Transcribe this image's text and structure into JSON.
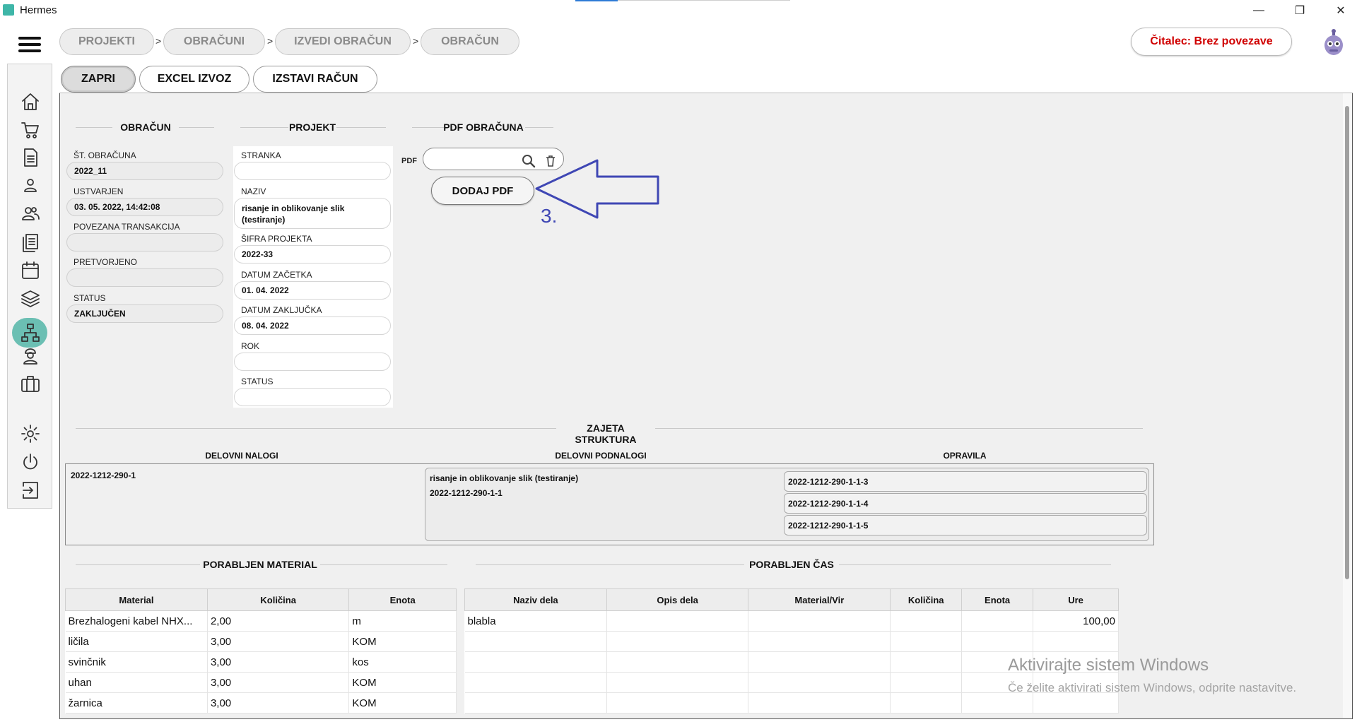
{
  "window": {
    "title": "Hermes",
    "minimize": "—",
    "maximize": "❐",
    "close": "✕"
  },
  "breadcrumb": [
    "PROJEKTI",
    "OBRAČUNI",
    "IZVEDI OBRAČUN",
    "OBRAČUN"
  ],
  "breadcrumb_sep": ">",
  "reader": "Čitalec: Brez povezave",
  "toolbar": {
    "close": "ZAPRI",
    "excel": "EXCEL IZVOZ",
    "invoice": "IZSTAVI RAČUN"
  },
  "obracun": {
    "title": "OBRAČUN",
    "fields": [
      {
        "label": "ŠT. OBRAČUNA",
        "value": "2022_11"
      },
      {
        "label": "USTVARJEN",
        "value": "03. 05. 2022, 14:42:08"
      },
      {
        "label": "POVEZANA TRANSAKCIJA",
        "value": ""
      },
      {
        "label": "PRETVORJENO",
        "value": ""
      },
      {
        "label": "STATUS",
        "value": "ZAKLJUČEN"
      }
    ]
  },
  "projekt": {
    "title": "PROJEKT",
    "fields": [
      {
        "label": "STRANKA",
        "value": ""
      },
      {
        "label": "NAZIV",
        "value": "risanje in oblikovanje slik (testiranje)"
      },
      {
        "label": "ŠIFRA PROJEKTA",
        "value": "2022-33"
      },
      {
        "label": "DATUM ZAČETKA",
        "value": "01. 04. 2022"
      },
      {
        "label": "DATUM ZAKLJUČKA",
        "value": "08. 04. 2022"
      },
      {
        "label": "ROK",
        "value": ""
      },
      {
        "label": "STATUS",
        "value": ""
      }
    ]
  },
  "pdf": {
    "title": "PDF OBRAČUNA",
    "label": "PDF",
    "value": "",
    "add_button": "DODAJ PDF",
    "annotation": "3."
  },
  "struktura": {
    "title": "ZAJETA STRUKTURA",
    "columns": [
      "DELOVNI NALOGI",
      "DELOVNI PODNALOGI",
      "OPRAVILA"
    ],
    "nalog": "2022-1212-290-1",
    "podnalog_name": "risanje in oblikovanje slik (testiranje)",
    "podnalog_id": "2022-1212-290-1-1",
    "opravila": [
      "2022-1212-290-1-1-3",
      "2022-1212-290-1-1-4",
      "2022-1212-290-1-1-5"
    ]
  },
  "material": {
    "title": "PORABLJEN MATERIAL",
    "columns": [
      "Material",
      "Količina",
      "Enota"
    ],
    "rows": [
      [
        "Brezhalogeni kabel NHX...",
        "2,00",
        "m"
      ],
      [
        "ličila",
        "3,00",
        "KOM"
      ],
      [
        "svinčnik",
        "3,00",
        "kos"
      ],
      [
        "uhan",
        "3,00",
        "KOM"
      ],
      [
        "žarnica",
        "3,00",
        "KOM"
      ]
    ]
  },
  "cas": {
    "title": "PORABLJEN ČAS",
    "columns": [
      "Naziv dela",
      "Opis dela",
      "Material/Vir",
      "Količina",
      "Enota",
      "Ure"
    ],
    "rows": [
      [
        "blabla",
        "",
        "",
        "",
        "",
        "100,00"
      ],
      [
        "",
        "",
        "",
        "",
        "",
        ""
      ],
      [
        "",
        "",
        "",
        "",
        "",
        ""
      ],
      [
        "",
        "",
        "",
        "",
        "",
        ""
      ],
      [
        "",
        "",
        "",
        "",
        "",
        ""
      ]
    ]
  },
  "watermark": {
    "line1": "Aktivirajte sistem Windows",
    "line2": "Če želite aktivirati sistem Windows, odprite nastavitve."
  },
  "sidebar_icons": [
    "home-icon",
    "cart-icon",
    "document-icon",
    "user-icon",
    "users-icon",
    "documents-icon",
    "calendar-icon",
    "layers-icon",
    "sitemap-icon",
    "worker-icon",
    "briefcase-icon",
    "gear-icon",
    "power-icon",
    "exit-icon"
  ]
}
